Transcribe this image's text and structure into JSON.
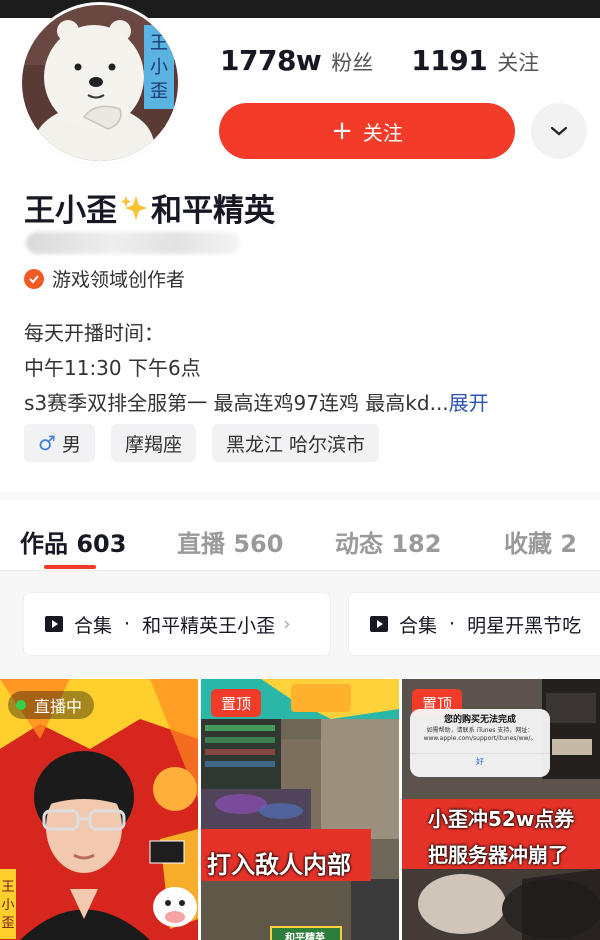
{
  "profile": {
    "fans_count": "1778w",
    "fans_label": "粉丝",
    "following_count": "1191",
    "following_label": "关注",
    "follow_button": "关注",
    "name_part1": "王小歪",
    "name_part2": "和平精英",
    "avatar_text": "王小歪",
    "creator_label": "游戏领域创作者",
    "bio_line1": "每天开播时间：",
    "bio_line2": "中午11:30 下午6点",
    "bio_line3": "s3赛季双排全服第一 最高连鸡97连鸡 最高kd...",
    "bio_expand": "展开",
    "tags": [
      "男",
      "摩羯座",
      "黑龙江 哈尔滨市"
    ]
  },
  "tabs": [
    {
      "label": "作品",
      "count": "603"
    },
    {
      "label": "直播",
      "count": "560"
    },
    {
      "label": "动态",
      "count": "182"
    },
    {
      "label": "收藏",
      "count": "2"
    }
  ],
  "collections": [
    {
      "prefix": "合集",
      "sep": "·",
      "title": "和平精英王小歪"
    },
    {
      "prefix": "合集",
      "sep": "·",
      "title": "明星开黑节吃"
    }
  ],
  "thumbnails": [
    {
      "badge": "直播中",
      "side_text": "王小歪"
    },
    {
      "badge": "置顶",
      "caption": "打入敌人内部",
      "banner": "和平精英"
    },
    {
      "badge": "置顶",
      "dialog_title": "您的购买无法完成",
      "dialog_body_1": "如需帮助，请联系 iTunes 支持，网址：",
      "dialog_body_2": "www.apple.com/support/itunes/ww/。",
      "dialog_ok": "好",
      "caption_1": "小歪冲52w点券",
      "caption_2": "把服务器冲崩了"
    }
  ],
  "colors": {
    "accent": "#f33b2a",
    "link": "#2d55b3"
  }
}
